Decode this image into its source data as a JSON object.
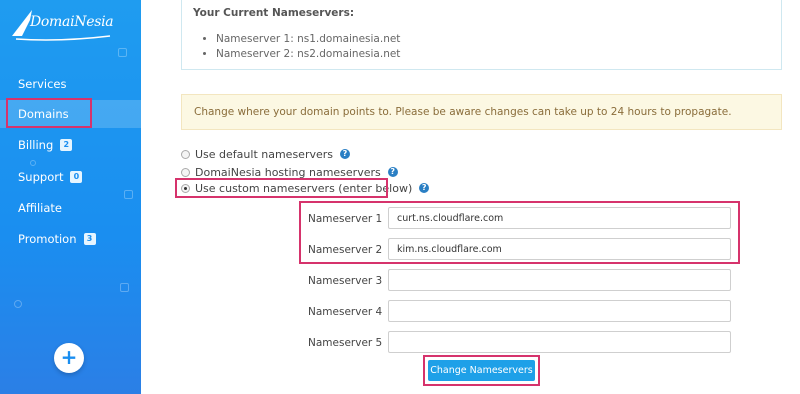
{
  "sidebar": {
    "logo_text": "DomaiNesia",
    "items": [
      {
        "label": "Services",
        "badge": ""
      },
      {
        "label": "Domains",
        "badge": ""
      },
      {
        "label": "Billing",
        "badge": "2"
      },
      {
        "label": "Support",
        "badge": "0"
      },
      {
        "label": "Affiliate",
        "badge": ""
      },
      {
        "label": "Promotion",
        "badge": "3"
      }
    ],
    "add_button": "+"
  },
  "current_ns": {
    "title": "Your Current Nameservers:",
    "items": [
      "Nameserver 1: ns1.domainesia.net",
      "Nameserver 2: ns2.domainesia.net"
    ]
  },
  "warning": "Change where your domain points to. Please be aware changes can take up to 24 hours to propagate.",
  "options": [
    {
      "label": "Use default nameservers",
      "checked": false
    },
    {
      "label": "DomaiNesia hosting nameservers",
      "checked": false
    },
    {
      "label": "Use custom nameservers (enter below)",
      "checked": true
    }
  ],
  "help_glyph": "?",
  "nameservers": [
    {
      "label": "Nameserver 1",
      "value": "curt.ns.cloudflare.com"
    },
    {
      "label": "Nameserver 2",
      "value": "kim.ns.cloudflare.com"
    },
    {
      "label": "Nameserver 3",
      "value": ""
    },
    {
      "label": "Nameserver 4",
      "value": ""
    },
    {
      "label": "Nameserver 5",
      "value": ""
    }
  ],
  "submit_label": "Change Nameservers",
  "colors": {
    "sidebar": "#1a8ef0",
    "highlight": "#d6336c",
    "button": "#1ea0e8",
    "warning_bg": "#fcf8e3"
  }
}
